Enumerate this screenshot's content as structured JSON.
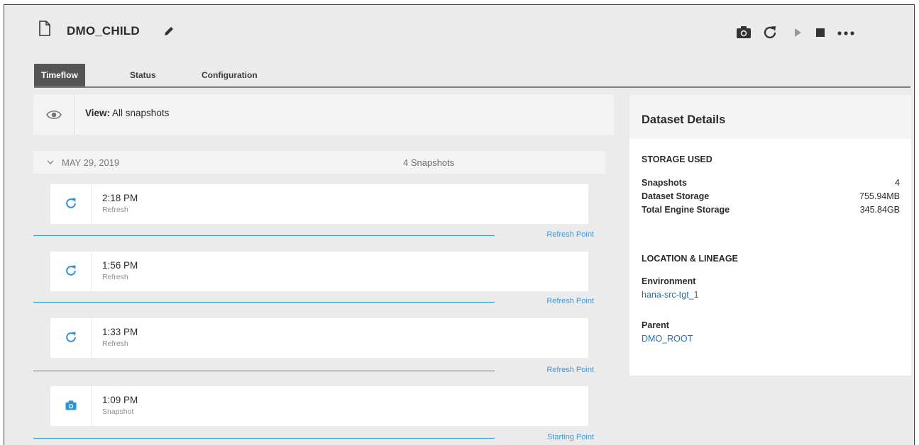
{
  "header": {
    "title": "DMO_CHILD",
    "file_icon": "file-icon",
    "edit_icon": "pencil-icon",
    "actions": [
      "camera-icon",
      "refresh-icon",
      "play-icon",
      "stop-icon",
      "more-icon"
    ]
  },
  "tabs": [
    {
      "label": "Timeflow",
      "active": true
    },
    {
      "label": "Status",
      "active": false
    },
    {
      "label": "Configuration",
      "active": false
    }
  ],
  "view": {
    "prefix": "View:",
    "value": "All snapshots",
    "icon": "eye-icon"
  },
  "timeline": {
    "date": "MAY 29, 2019",
    "count": "4 Snapshots",
    "snapshots": [
      {
        "time": "2:18 PM",
        "type": "Refresh",
        "icon": "refresh-icon",
        "point": "Refresh Point"
      },
      {
        "time": "1:56 PM",
        "type": "Refresh",
        "icon": "refresh-icon",
        "point": "Refresh Point"
      },
      {
        "time": "1:33 PM",
        "type": "Refresh",
        "icon": "refresh-icon",
        "point": "Refresh Point"
      },
      {
        "time": "1:09 PM",
        "type": "Snapshot",
        "icon": "camera-icon",
        "point": "Starting Point"
      }
    ]
  },
  "details": {
    "title": "Dataset Details",
    "storage_heading": "STORAGE USED",
    "storage": [
      {
        "label": "Snapshots",
        "value": "4"
      },
      {
        "label": "Dataset Storage",
        "value": "755.94MB"
      },
      {
        "label": "Total Engine Storage",
        "value": "345.84GB"
      }
    ],
    "lineage_heading": "LOCATION & LINEAGE",
    "environment_label": "Environment",
    "environment_value": "hana-src-tgt_1",
    "parent_label": "Parent",
    "parent_value": "DMO_ROOT"
  },
  "colors": {
    "accent": "#2e93d4",
    "link": "#1f6fb5",
    "tab_active": "#555555"
  }
}
